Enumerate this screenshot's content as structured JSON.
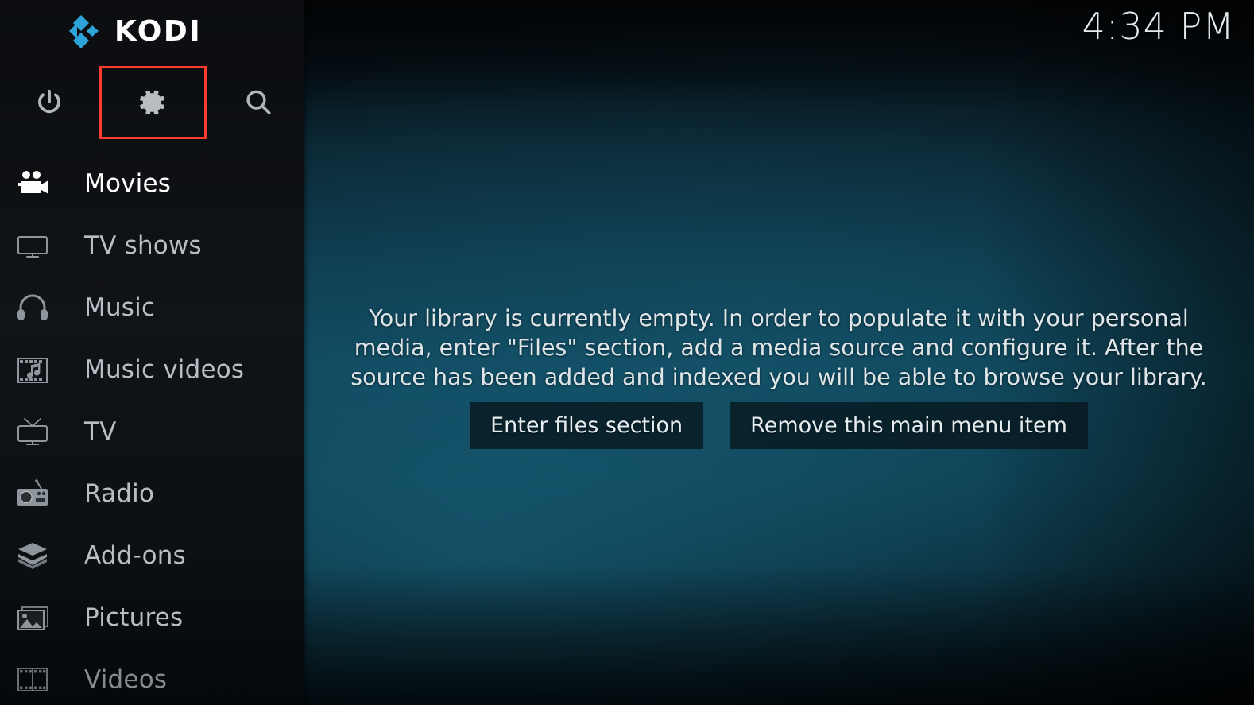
{
  "app": {
    "name": "KODI",
    "logo_color": "#2ea3d8"
  },
  "clock": {
    "time": "4:34 PM"
  },
  "sidebar": {
    "top_actions": [
      {
        "name": "power-icon",
        "label": "Power"
      },
      {
        "name": "settings-icon",
        "label": "Settings",
        "highlighted": true
      },
      {
        "name": "search-icon",
        "label": "Search"
      }
    ],
    "items": [
      {
        "label": "Movies",
        "icon": "movie-camera-icon",
        "active": true
      },
      {
        "label": "TV shows",
        "icon": "television-icon",
        "active": false
      },
      {
        "label": "Music",
        "icon": "headphones-icon",
        "active": false
      },
      {
        "label": "Music videos",
        "icon": "music-video-icon",
        "active": false
      },
      {
        "label": "TV",
        "icon": "tv-antenna-icon",
        "active": false
      },
      {
        "label": "Radio",
        "icon": "radio-icon",
        "active": false
      },
      {
        "label": "Add-ons",
        "icon": "addons-box-icon",
        "active": false
      },
      {
        "label": "Pictures",
        "icon": "pictures-icon",
        "active": false
      },
      {
        "label": "Videos",
        "icon": "film-strip-icon",
        "active": false
      }
    ]
  },
  "main": {
    "empty_message": "Your library is currently empty. In order to populate it with your personal media, enter \"Files\" section, add a media source and configure it. After the source has been added and indexed you will be able to browse your library.",
    "buttons": [
      {
        "label": "Enter files section",
        "name": "enter-files-section-button"
      },
      {
        "label": "Remove this main menu item",
        "name": "remove-main-menu-item-button"
      }
    ]
  },
  "annotation": {
    "highlight_color": "#ff3b30",
    "target": "settings-icon"
  }
}
